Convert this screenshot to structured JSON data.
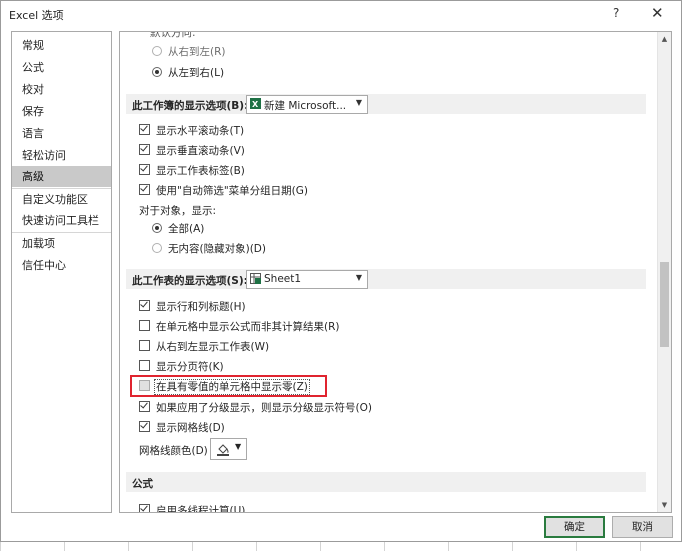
{
  "window": {
    "title": "Excel 选项",
    "help": "?",
    "close": "✕"
  },
  "nav": {
    "items": [
      {
        "label": "常规"
      },
      {
        "label": "公式"
      },
      {
        "label": "校对"
      },
      {
        "label": "保存"
      },
      {
        "label": "语言"
      },
      {
        "label": "轻松访问"
      },
      {
        "label": "高级",
        "active": true
      },
      {
        "label": "自定义功能区"
      },
      {
        "label": "快速访问工具栏"
      },
      {
        "label": "加载项"
      },
      {
        "label": "信任中心"
      }
    ]
  },
  "direction": {
    "rtl_label": "从右到左(R)",
    "ltr_label": "从左到右(L)"
  },
  "workbook_section": {
    "title": "此工作簿的显示选项(B):",
    "dropdown_value": "新建 Microsoft...",
    "options": [
      {
        "label": "显示水平滚动条(T)",
        "checked": true
      },
      {
        "label": "显示垂直滚动条(V)",
        "checked": true
      },
      {
        "label": "显示工作表标签(B)",
        "checked": true
      },
      {
        "label": "使用\"自动筛选\"菜单分组日期(G)",
        "checked": true
      }
    ],
    "objects_label": "对于对象，显示:",
    "objects_all": "全部(A)",
    "objects_none": "无内容(隐藏对象)(D)"
  },
  "worksheet_section": {
    "title": "此工作表的显示选项(S):",
    "dropdown_value": "Sheet1",
    "options": [
      {
        "label": "显示行和列标题(H)",
        "checked": true
      },
      {
        "label": "在单元格中显示公式而非其计算结果(R)",
        "checked": false
      },
      {
        "label": "从右到左显示工作表(W)",
        "checked": false
      },
      {
        "label": "显示分页符(K)",
        "checked": false
      },
      {
        "label": "在具有零值的单元格中显示零(Z)",
        "checked": false
      },
      {
        "label": "如果应用了分级显示，则显示分级显示符号(O)",
        "checked": true
      },
      {
        "label": "显示网格线(D)",
        "checked": true
      }
    ],
    "gridline_color_label": "网格线颜色(D)"
  },
  "formula_section": {
    "title": "公式",
    "first_option": "启用多线程计算(U)"
  },
  "buttons": {
    "ok": "确定",
    "cancel": "取消"
  },
  "colors": {
    "highlight_border": "#e0242f",
    "ok_border": "#2a7b3f",
    "nav_active": "#c9c9c9",
    "excel_green": "#1e7145"
  }
}
